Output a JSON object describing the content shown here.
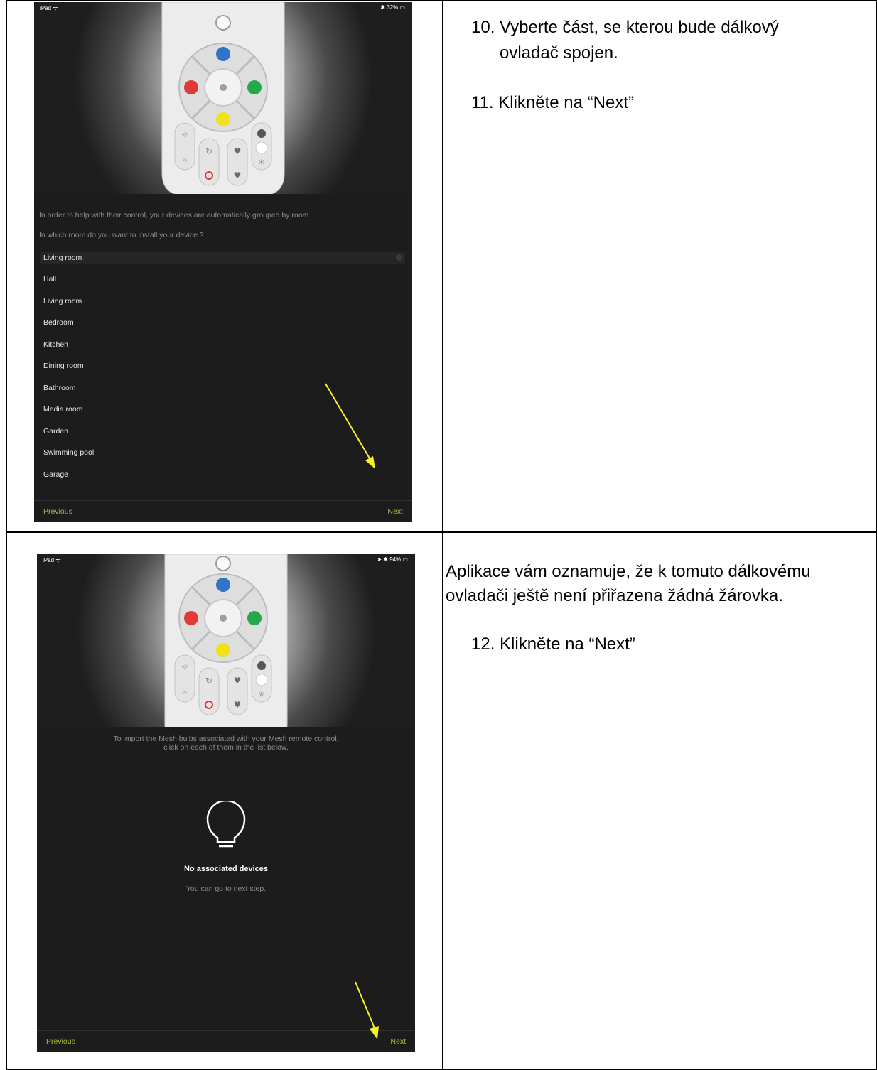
{
  "step_row_1": {
    "steps": [
      "10. Vyberte část, se kterou bude dálkový",
      "ovladač spojen.",
      "11. Klikněte na “Next”"
    ],
    "screen": {
      "status_left": "iPad ᯤ",
      "status_right": "✱ 32% ▭",
      "intro": "In order to help with their control, your devices are automatically grouped by room.",
      "question": "In which room do you want to install your device ?",
      "selected_room": "Living room",
      "rooms": [
        "Hall",
        "Living room",
        "Bedroom",
        "Kitchen",
        "Dining room",
        "Bathroom",
        "Media room",
        "Garden",
        "Swimming pool",
        "Garage"
      ],
      "previous_label": "Previous",
      "next_label": "Next"
    }
  },
  "step_row_2": {
    "intro_lines": [
      "Aplikace vám oznamuje, že k tomuto dálkovému",
      "ovladači ještě není přiřazena žádná žárovka."
    ],
    "step": "12. Klikněte na “Next”",
    "screen": {
      "status_left": "iPad ᯤ",
      "status_right": "➤ ✱ 94% ▭",
      "import_line_1": "To import the Mesh bulbs associated with your Mesh remote control,",
      "import_line_2": "click on each of them in the list below.",
      "empty_title": "No associated devices",
      "empty_subtitle": "You can go to next step.",
      "previous_label": "Previous",
      "next_label": "Next"
    }
  },
  "colors": {
    "accent_green": "#a9b93c",
    "arrow_yellow": "#f5f222",
    "button_blue": "#2f74c8",
    "button_red": "#e23a36",
    "button_green": "#24a84a",
    "button_yellow": "#f3e118"
  }
}
